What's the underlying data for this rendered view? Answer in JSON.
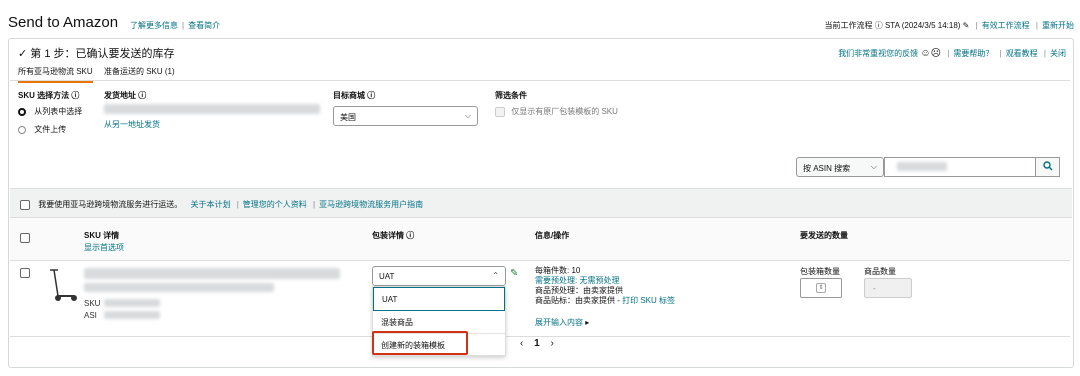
{
  "header": {
    "title": "Send to Amazon",
    "learn_more": "了解更多信息",
    "view_summary": "查看简介",
    "current_workflow": "当前工作流程 ⓘ STA (2024/3/5 14:18)",
    "valid_workflows": "有效工作流程",
    "new_start": "重新开始"
  },
  "step": {
    "title": "✓ 第 1 步：已确认要发送的库存",
    "feedback": "我们非常重视您的反馈",
    "help": "需要帮助？",
    "tutorial": "观看教程",
    "close": "关闭",
    "tabs": [
      "所有亚马逊物流 SKU",
      "准备运送的 SKU (1)"
    ]
  },
  "filters": {
    "sku_method_label": "SKU 选择方法 ⓘ",
    "method_list": "从列表中选择",
    "method_upload": "文件上传",
    "ship_from_label": "发货地址 ⓘ",
    "ship_from_other": "从另一地址发货",
    "marketplace_label": "目标商城 ⓘ",
    "marketplace_value": "美国",
    "filter_label": "筛选条件",
    "filter_option": "仅显示有原厂包装模板的 SKU",
    "search_by": "按 ASIN 搜索"
  },
  "program": {
    "text": "我要使用亚马逊跨境物流服务进行运送。",
    "about": "关于本计划",
    "manage_profile": "管理您的个人资料",
    "guide": "亚马逊跨境物流服务用户指南"
  },
  "table": {
    "col_sku": "SKU 详情",
    "show_options": "显示首选项",
    "col_packing": "包装详情 ⓘ",
    "col_info": "信息/操作",
    "col_qty": "要发送的数量"
  },
  "row": {
    "sku_prefix": "SKU",
    "asin_prefix": "ASI",
    "packing_value": "UAT",
    "units_per_box": "每箱件数: 10",
    "prep_needed": "需要预处理: 无需预处理",
    "prep_by": "商品预处理：由卖家提供",
    "label_by": "商品贴标：由卖家提供 - ",
    "print_label": "打印 SKU 标签",
    "expand": "展开输入内容",
    "boxes_label": "包装箱数量",
    "units_label": "商品数量",
    "units_value": "-"
  },
  "dropdown": {
    "options": [
      "UAT",
      "混装商品",
      "创建新的装箱模板"
    ],
    "highlight_color": "#d13212"
  },
  "pagination": {
    "prev": "‹",
    "page": "1",
    "next": "›"
  }
}
